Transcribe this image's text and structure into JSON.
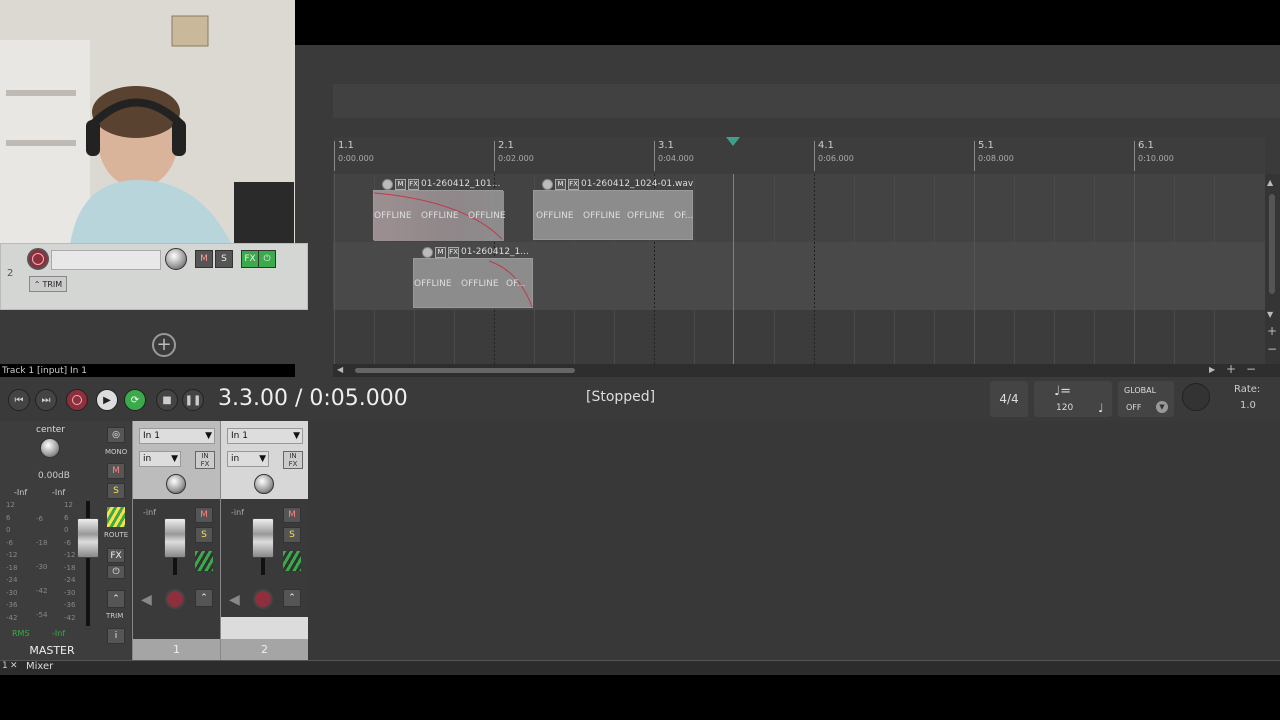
{
  "ruler": {
    "bars": [
      {
        "bar": "1.1",
        "time": "0:00.000"
      },
      {
        "bar": "2.1",
        "time": "0:02.000"
      },
      {
        "bar": "3.1",
        "time": "0:04.000"
      },
      {
        "bar": "4.1",
        "time": "0:06.000"
      },
      {
        "bar": "5.1",
        "time": "0:08.000"
      },
      {
        "bar": "6.1",
        "time": "0:10.000"
      }
    ]
  },
  "items": [
    {
      "name": "01-260412_101...",
      "offline": [
        "OFFLINE",
        "OFFLINE",
        "OFFLINE"
      ]
    },
    {
      "name": "01-260412_1024-01.wav",
      "offline": [
        "OFFLINE",
        "OFFLINE",
        "OFFLINE",
        "OF..."
      ]
    },
    {
      "name": "01-260412_1...",
      "offline": [
        "OFFLINE",
        "OFFLINE",
        "OF..."
      ]
    }
  ],
  "item_buttons": {
    "m": "M",
    "fx": "FX"
  },
  "tcp": {
    "track_number": "2",
    "m_label": "M",
    "s_label": "S",
    "fx_label": "FX",
    "trim_label": "TRIM",
    "add_track_icon": "plus-circle-icon",
    "info_text": "Track 1 [input] In 1"
  },
  "transport": {
    "time": "3.3.00 / 0:05.000",
    "status": "[Stopped]",
    "time_sig": "4/4",
    "tempo": "120",
    "global_label": "GLOBAL",
    "global_value": "OFF",
    "rate_label": "Rate:",
    "rate_value": "1.0"
  },
  "master": {
    "pan_label": "center",
    "volume": "0.00dB",
    "left_level": "-Inf",
    "right_level": "-Inf",
    "scale_left": [
      "12",
      "6",
      "0",
      "-6",
      "-12",
      "-18",
      "-24",
      "-30",
      "-36",
      "-42"
    ],
    "scale_mid": [
      "-6",
      "-18",
      "-30",
      "-42",
      "-54"
    ],
    "scale_right": [
      "12",
      "6",
      "0",
      "-6",
      "-12",
      "-18",
      "-24",
      "-30",
      "-36",
      "-42"
    ],
    "rms_label": "RMS",
    "rms_value": "-Inf",
    "name": "MASTER",
    "mono_label": "MONO",
    "m_label": "M",
    "s_label": "S",
    "route_label": "ROUTE",
    "fx_label": "FX",
    "trim_label": "TRIM",
    "info_label": "i"
  },
  "strips": [
    {
      "input": "In 1",
      "mode": "in",
      "level": "-inf",
      "m": "M",
      "s": "S",
      "number": "1"
    },
    {
      "input": "In 1",
      "mode": "in",
      "level": "-inf",
      "m": "M",
      "s": "S",
      "number": "2"
    }
  ],
  "strip_fx_label": "IN FX",
  "bottom": {
    "tab_label": "Mixer",
    "tab_index": "1"
  },
  "colors": {
    "record": "#8d2f3c",
    "play_cursor": "#3fa08a",
    "fx_green": "#3aaa4a",
    "envelope": "#c0394a"
  }
}
